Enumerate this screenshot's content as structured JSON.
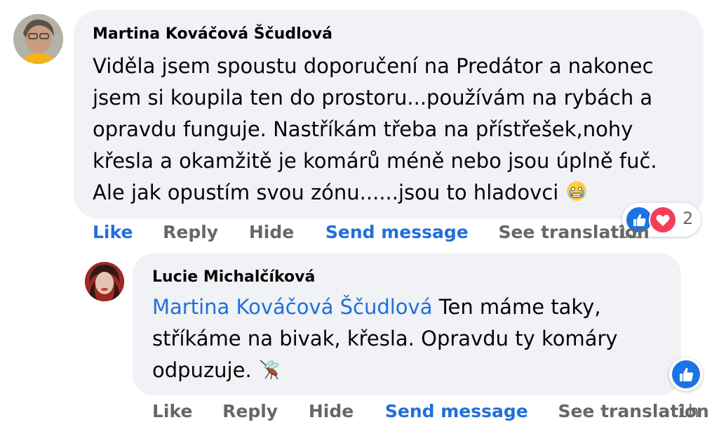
{
  "comment": {
    "author": "Martina Kováčová Ščudlová",
    "lines": [
      "Viděla jsem spoustu doporučení na Predátor a nakonec",
      "jsem si koupila ten do prostoru...používám na rybách a",
      "opravdu funguje. Nastříkám třeba na přístřešek,nohy",
      "křesla a okamžitě je komárů méně nebo jsou úplně fuč.",
      "Ale jak opustím svou zónu......jsou to hladovci"
    ],
    "emoji": "grimacing-tears-emoji",
    "reactions": {
      "count": "2",
      "types": [
        "like",
        "love"
      ]
    },
    "actions": {
      "like": "Like",
      "reply": "Reply",
      "hide": "Hide",
      "send_message": "Send message",
      "see_translation": "See translation",
      "time": "1d"
    }
  },
  "reply": {
    "author": "Lucie Michalčíková",
    "mention": "Martina Kováčová Ščudlová",
    "line1_rest": " Ten máme taky,",
    "line2": "stříkáme na bivak, křesla. Opravdu ty komáry",
    "line3": "odpuzuje. ",
    "emoji": "mosquito-emoji",
    "reactions": {
      "types": [
        "like"
      ]
    },
    "actions": {
      "like": "Like",
      "reply": "Reply",
      "hide": "Hide",
      "send_message": "Send message",
      "see_translation": "See translation",
      "time": "1h"
    }
  },
  "colors": {
    "bubble": "#f0f2f5",
    "link_blue": "#216fdb",
    "muted_grey": "#65676b",
    "like_blue": "#1b74e4",
    "love_red": "#f33e58"
  }
}
